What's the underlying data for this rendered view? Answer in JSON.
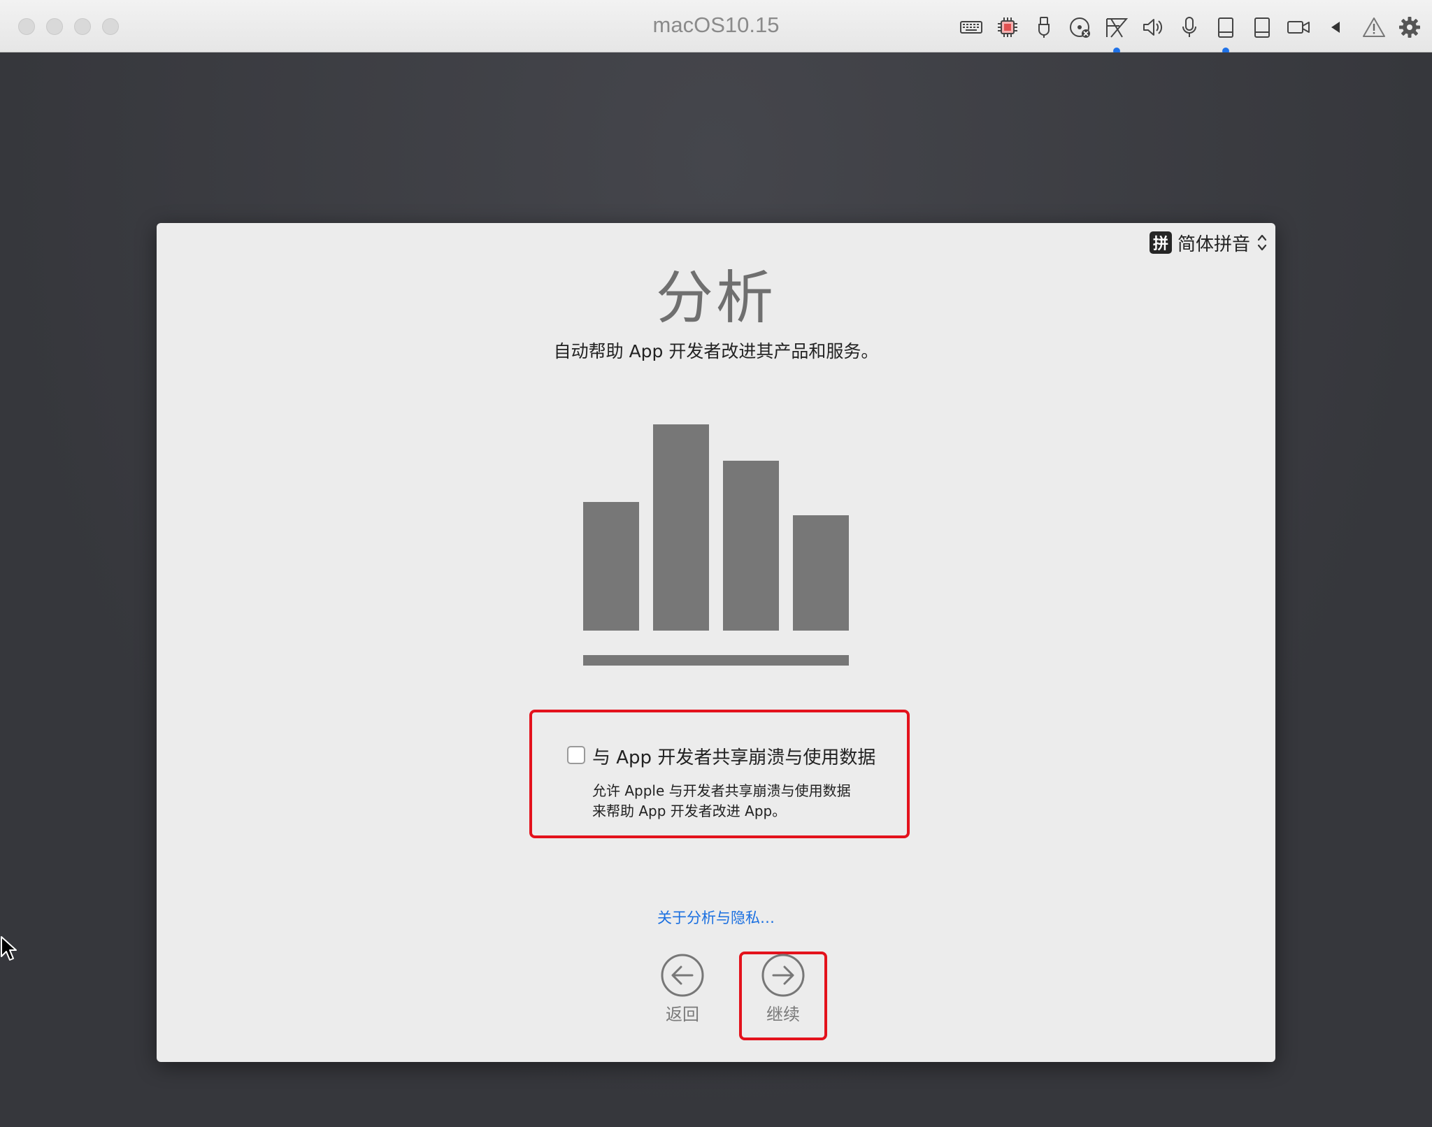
{
  "window": {
    "title": "macOS10.15"
  },
  "toolbar": {
    "icons": [
      "keyboard-icon",
      "cpu-icon",
      "usb-icon",
      "cd-icon",
      "network-icon",
      "speaker-icon",
      "microphone-icon",
      "drive-icon",
      "drive-alt-icon",
      "camera-icon",
      "back-triangle-icon",
      "warning-icon",
      "gear-icon"
    ],
    "active_indicator_color": "#1f72e8"
  },
  "input_method": {
    "badge": "拼",
    "label": "简体拼音"
  },
  "dialog": {
    "title": "分析",
    "subtitle": "自动帮助 App 开发者改进其产品和服务。"
  },
  "share": {
    "checked": false,
    "label": "与 App 开发者共享崩溃与使用数据",
    "description_line1": "允许 Apple 与开发者共享崩溃与使用数据",
    "description_line2": "来帮助 App 开发者改进 App。"
  },
  "links": {
    "privacy": "关于分析与隐私…"
  },
  "navigation": {
    "back_label": "返回",
    "continue_label": "继续"
  },
  "colors": {
    "highlight": "#e3121c",
    "link": "#1a6fe0",
    "graphic": "#777777"
  }
}
